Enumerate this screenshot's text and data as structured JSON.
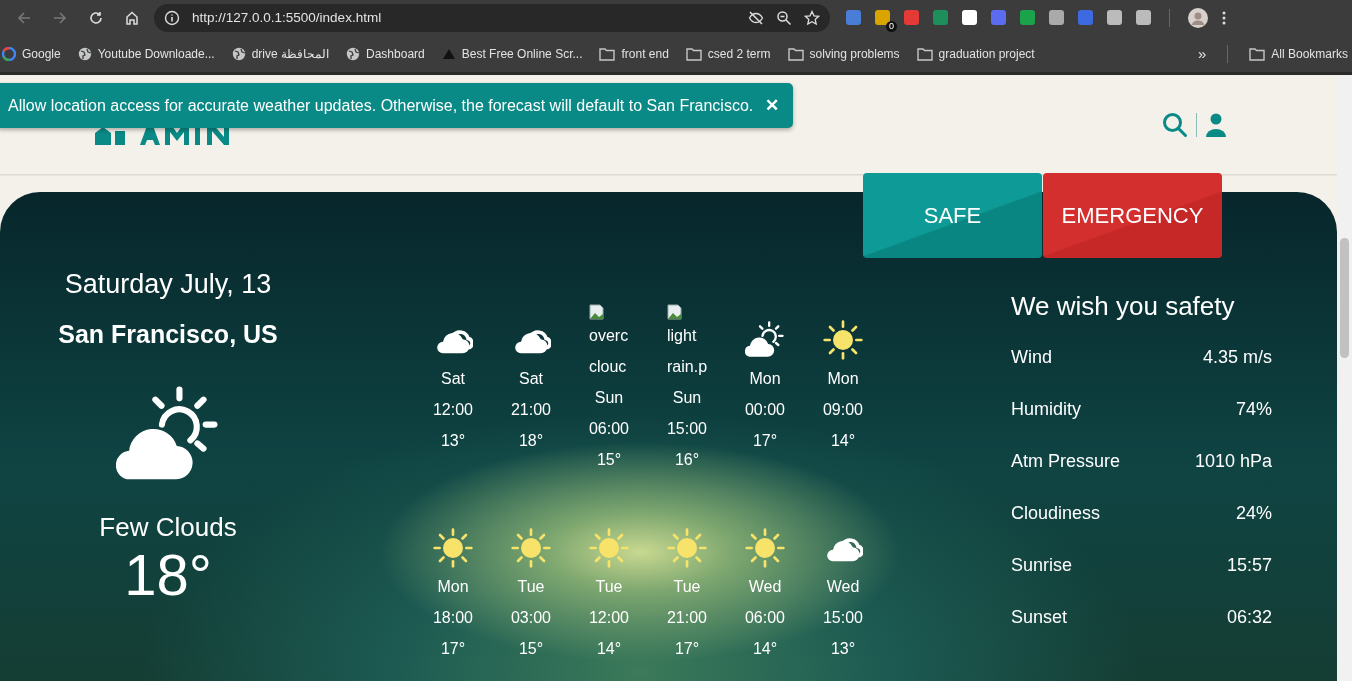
{
  "browser": {
    "url": "http://127.0.0.1:5500/index.html",
    "bookmarks": [
      {
        "label": "Google",
        "kind": "google"
      },
      {
        "label": "Youtube Downloade...",
        "kind": "site"
      },
      {
        "label": "drive المحافظة",
        "kind": "site"
      },
      {
        "label": "Dashboard",
        "kind": "site"
      },
      {
        "label": "Best Free Online Scr...",
        "kind": "app"
      },
      {
        "label": "front end",
        "kind": "folder"
      },
      {
        "label": "csed 2 term",
        "kind": "folder"
      },
      {
        "label": "solving problems",
        "kind": "folder"
      },
      {
        "label": "graduation project",
        "kind": "folder"
      }
    ],
    "more": "»",
    "all_bookmarks": "All Bookmarks",
    "extension_badge": "0"
  },
  "toast": {
    "message": "Allow location access for accurate weather updates. Otherwise, the forecast will default to San Francisco.",
    "close": "✕"
  },
  "buttons": [
    {
      "label": "SAFE",
      "kind": "safe"
    },
    {
      "label": "EMERGENCY",
      "kind": "emergency"
    }
  ],
  "current": {
    "date": "Saturday July, 13",
    "city": "San Francisco, US",
    "kind": "partly",
    "description": "Few Clouds",
    "temp": "18°"
  },
  "forecast": [
    [
      {
        "kind": "clouds",
        "day": "Sat",
        "time": "12:00",
        "temp": "13°"
      },
      {
        "kind": "clouds",
        "day": "Sat",
        "time": "21:00",
        "temp": "18°"
      },
      {
        "kind": "broken",
        "alt": [
          "overc",
          "clouc"
        ],
        "day": "Sun",
        "time": "06:00",
        "temp": "15°"
      },
      {
        "kind": "broken",
        "alt": [
          "light",
          "rain.p"
        ],
        "day": "Sun",
        "time": "15:00",
        "temp": "16°"
      },
      {
        "kind": "partly",
        "day": "Mon",
        "time": "00:00",
        "temp": "17°"
      },
      {
        "kind": "sun",
        "day": "Mon",
        "time": "09:00",
        "temp": "14°"
      }
    ],
    [
      {
        "kind": "sun",
        "day": "Mon",
        "time": "18:00",
        "temp": "17°"
      },
      {
        "kind": "sun",
        "day": "Tue",
        "time": "03:00",
        "temp": "15°"
      },
      {
        "kind": "sun",
        "day": "Tue",
        "time": "12:00",
        "temp": "14°"
      },
      {
        "kind": "sun",
        "day": "Tue",
        "time": "21:00",
        "temp": "17°"
      },
      {
        "kind": "sun",
        "day": "Wed",
        "time": "06:00",
        "temp": "14°"
      },
      {
        "kind": "clouds",
        "day": "Wed",
        "time": "15:00",
        "temp": "13°"
      }
    ]
  ],
  "details": {
    "title": "We wish you safety",
    "rows": [
      {
        "label": "Wind",
        "value": "4.35 m/s"
      },
      {
        "label": "Humidity",
        "value": "74%"
      },
      {
        "label": "Atm Pressure",
        "value": "1010 hPa"
      },
      {
        "label": "Cloudiness",
        "value": "24%"
      },
      {
        "label": "Sunrise",
        "value": "15:57"
      },
      {
        "label": "Sunset",
        "value": "06:32"
      }
    ]
  }
}
